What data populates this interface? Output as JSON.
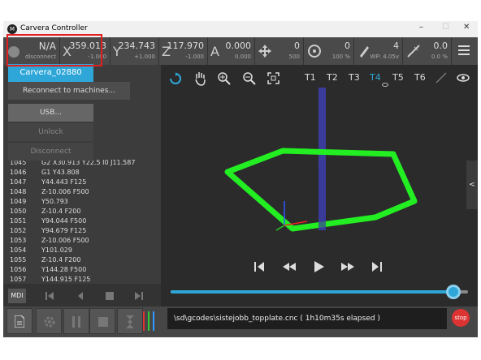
{
  "window": {
    "title": "Carvera Controller",
    "controls": [
      "–",
      "☐",
      "✕"
    ]
  },
  "status": {
    "conn": {
      "value": "N/A",
      "sub": "disconnect"
    },
    "x": {
      "label": "X",
      "value": "359.013",
      "sub": "-1.000"
    },
    "y": {
      "label": "Y",
      "value": "234.743",
      "sub": "+1.000"
    },
    "z": {
      "label": "Z",
      "value": "117.970",
      "sub": "-1.000"
    },
    "a": {
      "label": "A",
      "value": "0.000",
      "sub": "0.000"
    },
    "feed": {
      "value": "0",
      "sub": "500"
    },
    "spindle": {
      "value": "0",
      "sub": "100 %"
    },
    "tool": {
      "value": "4",
      "sub": "WP: 4.05v"
    },
    "laser": {
      "value": "0.0",
      "sub": "0.0 %"
    }
  },
  "popup": {
    "selected": "Carvera_02880",
    "items": [
      "Reconnect to machines...",
      "USB...",
      "Unlock",
      "Disconnect"
    ]
  },
  "gcode": [
    {
      "n": "1045",
      "c": "G2 X30.913 Y22.5 I0 J11.587"
    },
    {
      "n": "1046",
      "c": "G1 Y43.808"
    },
    {
      "n": "1047",
      "c": "Y44.443 F125"
    },
    {
      "n": "1048",
      "c": "Z-10.006 F500"
    },
    {
      "n": "1049",
      "c": "Y50.793"
    },
    {
      "n": "1050",
      "c": "Z-10.4 F200"
    },
    {
      "n": "1051",
      "c": "Y94.044 F500"
    },
    {
      "n": "1052",
      "c": "Y94.679 F125"
    },
    {
      "n": "1053",
      "c": "Z-10.006 F500"
    },
    {
      "n": "1054",
      "c": "Y101.029"
    },
    {
      "n": "1055",
      "c": "Z-10.4 F200"
    },
    {
      "n": "1056",
      "c": "Y144.28 F500"
    },
    {
      "n": "1057",
      "c": "Y144.915 F125"
    }
  ],
  "mdi_label": "MDI",
  "tools": [
    "T1",
    "T2",
    "T3",
    "T4",
    "T5",
    "T6"
  ],
  "active_tool": "T4",
  "playback": {
    "progress": 0.95
  },
  "file_status": "\\sd\\gcodes\\sistejobb_topplate.cnc ( 1h10m35s elapsed )",
  "stop_label": "stop",
  "collapse_label": "<"
}
